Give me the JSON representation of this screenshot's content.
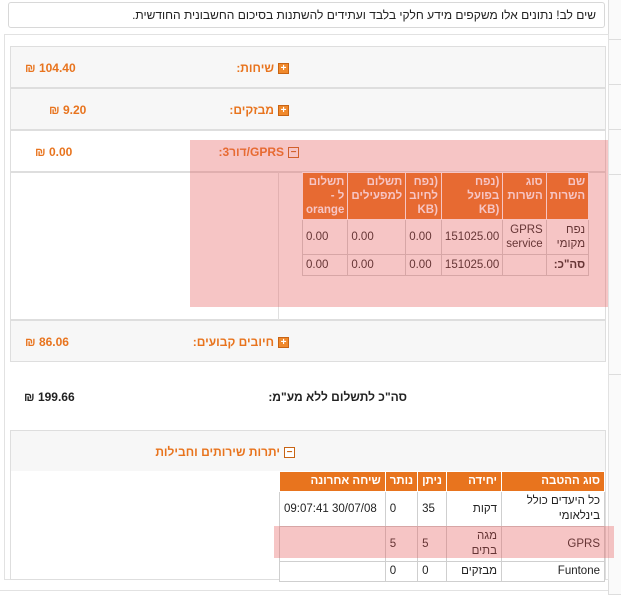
{
  "notice": "שים לב! נתונים אלו משקפים מידע חלקי בלבד ועתידים להשתנות בסיכום החשבונית החודשית.",
  "currency_symbol": "₪",
  "sections": {
    "calls": {
      "label": "שיחות:",
      "amount": "104.40",
      "toggle": "+"
    },
    "messages": {
      "label": "מבזקים:",
      "amount": "9.20",
      "toggle": "+"
    },
    "gprs": {
      "label": "GPRS/דור3:",
      "amount": "0.00",
      "toggle": "−"
    },
    "fixed": {
      "label": "חיובים קבועים:",
      "amount": "86.06",
      "toggle": "+"
    }
  },
  "gprs_table": {
    "headers": [
      "שם השרות",
      "סוג השרות",
      "(נפח בפועל (KB",
      "(נפח לחיוב (KB",
      "תשלום למפעילים",
      "תשלום ל - orange"
    ],
    "rows": [
      [
        "נפח מקומי",
        "GPRS service",
        "151025.00",
        "0.00",
        "0.00",
        "0.00"
      ]
    ],
    "total_row": [
      "סה\"כ:",
      "",
      "151025.00",
      "0.00",
      "0.00",
      "0.00"
    ]
  },
  "total": {
    "label": "סה\"כ לתשלום ללא מע\"מ:",
    "amount": "199.66"
  },
  "balances": {
    "label": "יתרות שירותים וחבילות",
    "toggle": "−",
    "headers": [
      "סוג ההטבה",
      "יחידה",
      "ניתן",
      "נותר",
      "שיחה אחרונה"
    ],
    "rows": [
      [
        "כל היעדים כולל בינלאומי",
        "דקות",
        "35",
        "0",
        "30/07/08 09:07:41"
      ],
      [
        "GPRS",
        "מגה בתים",
        "5",
        "5",
        ""
      ],
      [
        "Funtone",
        "מבזקים",
        "0",
        "0",
        ""
      ]
    ]
  },
  "colors": {
    "accent": "#e8741e",
    "highlight": "rgba(228,90,90,0.35)"
  }
}
